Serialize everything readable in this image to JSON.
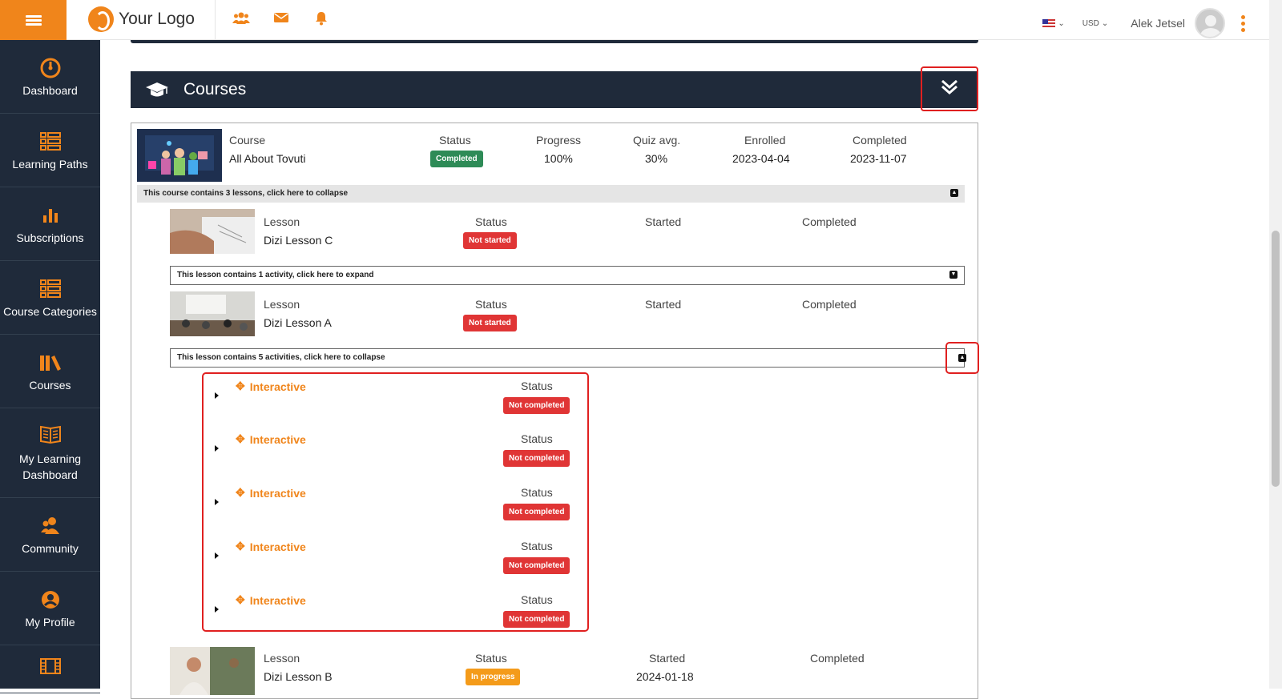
{
  "header": {
    "logo_text": "Your Logo",
    "currency": "USD",
    "user_name": "Alek Jetsel",
    "icons": [
      "menu-icon",
      "community-icon",
      "mail-icon",
      "bell-icon",
      "us-flag-icon",
      "avatar",
      "kebab-menu-icon"
    ]
  },
  "sidebar": {
    "items": [
      {
        "label": "Dashboard",
        "icon": "dashboard-icon"
      },
      {
        "label": "Learning Paths",
        "icon": "learning-paths-icon"
      },
      {
        "label": "Subscriptions",
        "icon": "subscriptions-icon"
      },
      {
        "label": "Course Categories",
        "icon": "categories-icon"
      },
      {
        "label": "Courses",
        "icon": "courses-icon"
      },
      {
        "label": "My Learning Dashboard",
        "icon": "book-icon"
      },
      {
        "label": "Community",
        "icon": "community-icon"
      },
      {
        "label": "My Profile",
        "icon": "profile-icon"
      }
    ]
  },
  "courses_section": {
    "title": "Courses"
  },
  "course": {
    "labels": {
      "course": "Course",
      "status": "Status",
      "progress": "Progress",
      "quiz_avg": "Quiz avg.",
      "enrolled": "Enrolled",
      "completed": "Completed"
    },
    "name": "All About Tovuti",
    "status": "Completed",
    "progress": "100%",
    "quiz_avg": "30%",
    "enrolled": "2023-04-04",
    "completed_date": "2023-11-07",
    "toggle_text": "This course contains 3 lessons, click here to collapse"
  },
  "lesson_labels": {
    "lesson": "Lesson",
    "status": "Status",
    "started": "Started",
    "completed": "Completed"
  },
  "lessons": [
    {
      "name": "Dizi Lesson C",
      "status": "Not started",
      "started": "",
      "completed": "",
      "toggle_text": "This lesson contains 1 activity, click here to expand"
    },
    {
      "name": "Dizi Lesson A",
      "status": "Not started",
      "started": "",
      "completed": "",
      "toggle_text": "This lesson contains 5 activities, click here to collapse"
    },
    {
      "name": "Dizi Lesson B",
      "status": "In progress",
      "started": "2024-01-18",
      "completed": ""
    }
  ],
  "activities": {
    "status_label": "Status",
    "items": [
      {
        "title": "Interactive",
        "status": "Not completed"
      },
      {
        "title": "Interactive",
        "status": "Not completed"
      },
      {
        "title": "Interactive",
        "status": "Not completed"
      },
      {
        "title": "Interactive",
        "status": "Not completed"
      },
      {
        "title": "Interactive",
        "status": "Not completed"
      }
    ]
  },
  "colors": {
    "accent": "#f0851b",
    "sidebar_bg": "#1f2a3a",
    "completed_green": "#2e8b57",
    "status_red": "#e03535",
    "in_progress_orange": "#f49b1a",
    "highlight_red": "#e02020"
  }
}
